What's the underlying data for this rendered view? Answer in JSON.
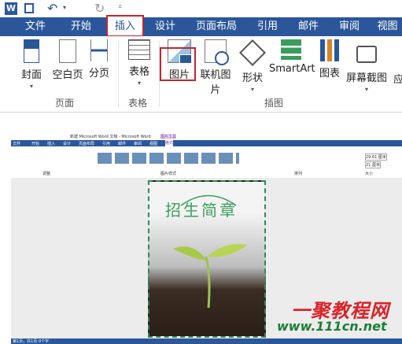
{
  "title_bar": {
    "word_icon": "word-icon",
    "save_icon": "save-icon",
    "undo_icon": "undo-icon",
    "redo_icon": "redo-icon",
    "customize_icon": "chevron-down-icon"
  },
  "tabs": [
    {
      "label": "文件"
    },
    {
      "label": "开始"
    },
    {
      "label": "插入"
    },
    {
      "label": "设计"
    },
    {
      "label": "页面布局"
    },
    {
      "label": "引用"
    },
    {
      "label": "邮件"
    },
    {
      "label": "审阅"
    },
    {
      "label": "视图"
    }
  ],
  "ribbon": {
    "groups": [
      {
        "label": "页面"
      },
      {
        "label": "表格"
      },
      {
        "label": "插图"
      }
    ],
    "buttons": [
      {
        "label": "封面",
        "icon": "cover-page-icon"
      },
      {
        "label": "空白页",
        "icon": "blank-page-icon"
      },
      {
        "label": "分页",
        "icon": "page-break-icon"
      },
      {
        "label": "表格",
        "icon": "table-icon"
      },
      {
        "label": "图片",
        "icon": "picture-icon"
      },
      {
        "label": "联机图片",
        "icon": "online-picture-icon"
      },
      {
        "label": "形状",
        "icon": "shapes-icon"
      },
      {
        "label": "SmartArt",
        "icon": "smartart-icon"
      },
      {
        "label": "图表",
        "icon": "chart-icon"
      },
      {
        "label": "屏幕截图",
        "icon": "screenshot-icon"
      },
      {
        "label": "应",
        "icon": ""
      }
    ]
  },
  "mini_word": {
    "title": "新建 Microsoft Word 文档 - Microsoft Word",
    "tool_tab": "图片工具",
    "tabs": [
      "文件",
      "开始",
      "插入",
      "设计",
      "页面布局",
      "引用",
      "邮件",
      "审阅",
      "视图",
      "格式"
    ],
    "ribbon_groups": [
      "调整",
      "图片样式",
      "排列",
      "大小"
    ],
    "size_height": "29.61 厘米",
    "size_width": "21 厘米",
    "status": "第1页，共1页   0个字",
    "doc_heading": "招生简章",
    "accent_green": "#2e8b57"
  },
  "watermark": {
    "brand": "一聚教程网",
    "url": "www.111cn.net"
  }
}
